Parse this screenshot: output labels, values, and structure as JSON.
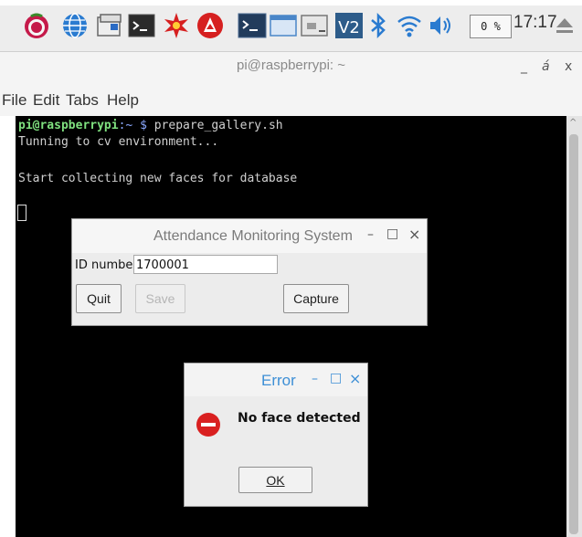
{
  "taskbar": {
    "cpu": "0 %",
    "clock": "17:17",
    "icons": [
      "raspberry-menu-icon",
      "web-browser-icon",
      "file-manager-icon",
      "terminal-icon",
      "mathematica-icon",
      "wolfram-icon",
      "terminal-window-icon",
      "window-button-icon",
      "window-button-2-icon",
      "vnc-icon",
      "bluetooth-icon",
      "wifi-icon",
      "volume-icon",
      "eject-icon"
    ]
  },
  "terminal_window": {
    "title": "pi@raspberrypi: ~",
    "controls": {
      "minimize": "_",
      "maximize": "á",
      "close": "x"
    },
    "menu": [
      "File",
      "Edit",
      "Tabs",
      "Help"
    ],
    "prompt_user": "pi@raspberrypi",
    "prompt_path": ":~",
    "prompt_symbol": "$",
    "command": "prepare_gallery.sh",
    "lines": [
      "Tunning to cv environment...",
      "",
      "Start collecting new faces for database"
    ]
  },
  "attendance_dialog": {
    "title": "Attendance Monitoring System",
    "controls": {
      "minimize": "–",
      "maximize": "□",
      "close": "×"
    },
    "id_label": "ID number",
    "id_value": "1700001",
    "quit_label": "Quit",
    "save_label": "Save",
    "capture_label": "Capture"
  },
  "error_dialog": {
    "title": "Error",
    "controls": {
      "minimize": "–",
      "maximize": "□",
      "close": "×"
    },
    "message": "No face detected",
    "ok_label": "OK",
    "title_color": "#3d8fd6"
  }
}
